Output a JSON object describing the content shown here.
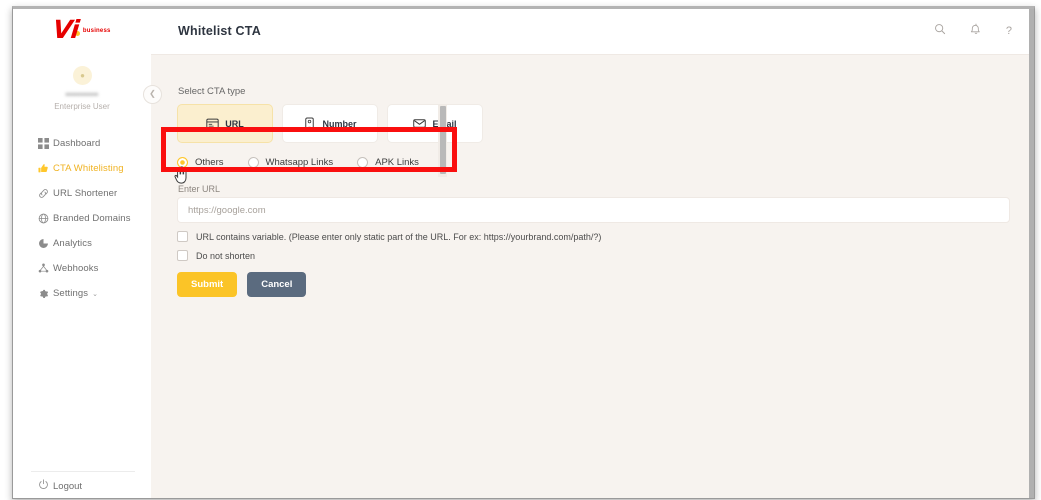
{
  "window": {
    "title": "Whitelist CTA"
  },
  "sidebar": {
    "logo": {
      "mark": "Vi",
      "sub": "business"
    },
    "user": {
      "name": "••••••••••",
      "role": "Enterprise User",
      "avatar_icon": "user-avatar-icon"
    },
    "collapse_icon": "chevron-left-icon",
    "items": [
      {
        "label": "Dashboard",
        "icon": "grid-icon",
        "active": false
      },
      {
        "label": "CTA Whitelisting",
        "icon": "thumbs-up-icon",
        "active": true
      },
      {
        "label": "URL Shortener",
        "icon": "link-icon",
        "active": false
      },
      {
        "label": "Branded Domains",
        "icon": "globe-icon",
        "active": false
      },
      {
        "label": "Analytics",
        "icon": "pie-chart-icon",
        "active": false
      },
      {
        "label": "Webhooks",
        "icon": "share-nodes-icon",
        "active": false
      },
      {
        "label": "Settings",
        "icon": "gear-icon",
        "active": false,
        "chevron": "⌄"
      }
    ],
    "logout": {
      "label": "Logout",
      "icon": "power-icon"
    }
  },
  "topbar": {
    "icons": [
      {
        "name": "search-icon",
        "glyph": "⌕"
      },
      {
        "name": "bell-icon",
        "glyph": "🔔"
      },
      {
        "name": "help-icon",
        "glyph": "?"
      }
    ]
  },
  "form": {
    "section_label": "Select CTA type",
    "cta_types": [
      {
        "label": "URL",
        "icon": "browser-window-icon",
        "selected": true
      },
      {
        "label": "Number",
        "icon": "phone-icon",
        "selected": false
      },
      {
        "label": "Email",
        "icon": "envelope-icon",
        "selected": false
      }
    ],
    "link_options": [
      {
        "label": "Others",
        "checked": true
      },
      {
        "label": "Whatsapp Links",
        "checked": false
      },
      {
        "label": "APK Links",
        "checked": false
      }
    ],
    "url_field": {
      "label": "Enter URL",
      "placeholder": "https://google.com",
      "value": ""
    },
    "checkboxes": [
      {
        "label": "URL contains variable. (Please enter only static part of the URL. For ex: https://yourbrand.com/path/?)",
        "checked": false
      },
      {
        "label": "Do not shorten",
        "checked": false
      }
    ],
    "submit_label": "Submit",
    "cancel_label": "Cancel"
  },
  "annotation": {
    "name": "highlight-box",
    "color": "#fa0f0f"
  },
  "colors": {
    "accent_yellow": "#ffc72c",
    "brand_red": "#e60000",
    "submit": "#fbc427",
    "cancel": "#5b6b7f",
    "canvas": "#f7f3ef"
  }
}
